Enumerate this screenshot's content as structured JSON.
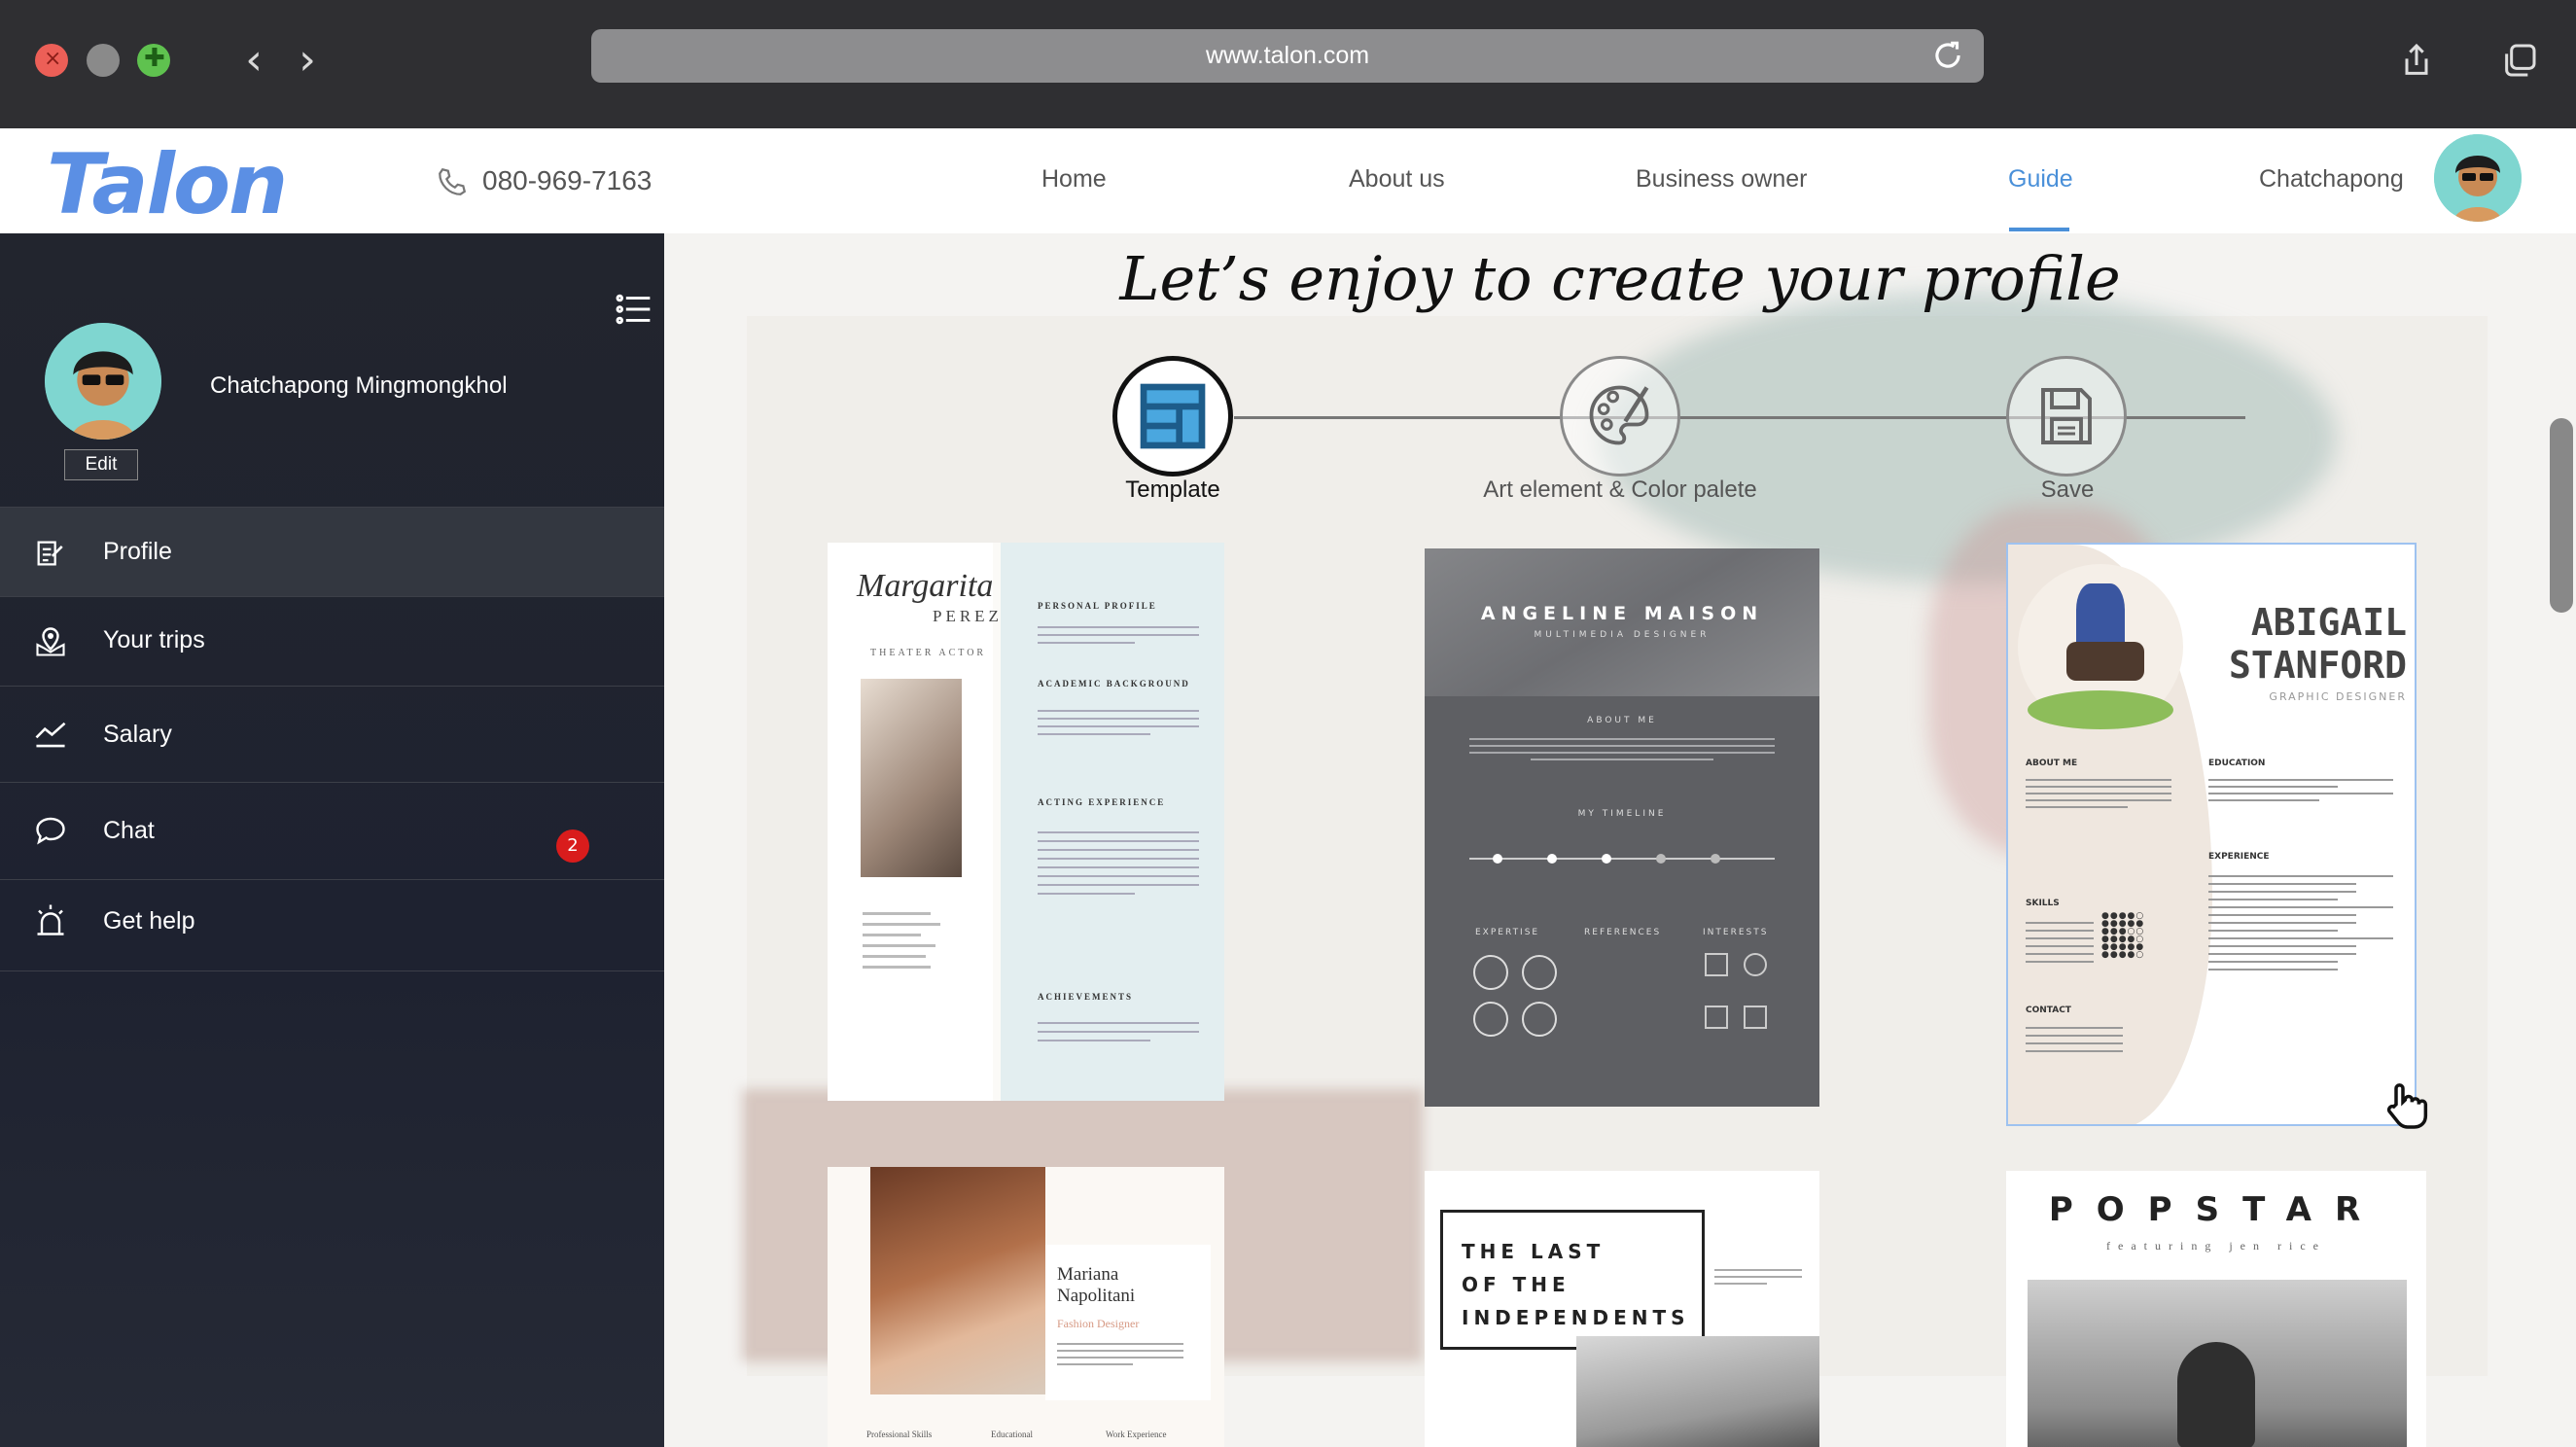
{
  "browser": {
    "url": "www.talon.com"
  },
  "header": {
    "logo": "Talon",
    "phone": "080-969-7163",
    "nav": [
      "Home",
      "About us",
      "Business owner",
      "Guide",
      "Chatchapong"
    ],
    "active_nav": "Guide",
    "accent": "#4a90d9"
  },
  "sidebar": {
    "user_name": "Chatchapong Mingmongkhol",
    "edit_label": "Edit",
    "items": [
      {
        "label": "Profile",
        "icon": "profile-edit-icon"
      },
      {
        "label": "Your trips",
        "icon": "map-pin-icon"
      },
      {
        "label": "Salary",
        "icon": "chart-line-icon"
      },
      {
        "label": "Chat",
        "icon": "chat-bubble-icon",
        "badge": "2"
      },
      {
        "label": "Get help",
        "icon": "alarm-icon"
      }
    ]
  },
  "main": {
    "headline": "Let’s enjoy to create your profile",
    "steps": [
      {
        "label": "Template",
        "icon": "template-layout-icon",
        "active": true
      },
      {
        "label": "Art element & Color palete",
        "icon": "palette-icon",
        "active": false
      },
      {
        "label": "Save",
        "icon": "floppy-disk-icon",
        "active": false
      }
    ],
    "templates": [
      {
        "name": "Margarita",
        "surname": "PEREZ",
        "role": "THEATER ACTOR",
        "sections": [
          "PERSONAL PROFILE",
          "ACADEMIC BACKGROUND",
          "ACTING EXPERIENCE",
          "ACHIEVEMENTS"
        ]
      },
      {
        "name": "ANGELINE MAISON",
        "role": "MULTIMEDIA DESIGNER",
        "sections": [
          "ABOUT ME",
          "MY TIMELINE",
          "EXPERTISE",
          "REFERENCES",
          "INTERESTS"
        ]
      },
      {
        "name_line1": "ABIGAIL",
        "name_line2": "STANFORD",
        "role": "GRAPHIC DESIGNER",
        "sections": [
          "ABOUT ME",
          "EDUCATION",
          "EXPERIENCE",
          "SKILLS",
          "CONTACT"
        ]
      },
      {
        "name_line1": "Mariana",
        "name_line2": "Napolitani",
        "role": "Fashion Designer",
        "sections": [
          "Professional Skills",
          "Educational",
          "Work Experience"
        ]
      },
      {
        "title": [
          "THE LAST",
          "OF THE",
          "INDEPENDENTS"
        ]
      },
      {
        "title": "POPSTAR",
        "subtitle": "featuring jen rice"
      }
    ]
  }
}
